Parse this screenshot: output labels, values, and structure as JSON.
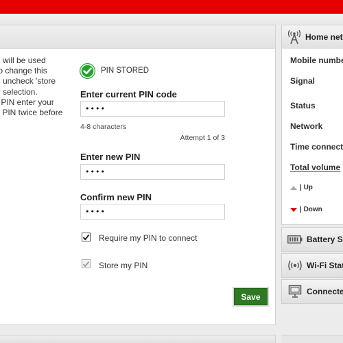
{
  "colors": {
    "brand_red": "#e60000",
    "ok_green": "#23a12e",
    "save_green": "#2d7a22",
    "down_red": "#e00000"
  },
  "help_text": "d will be used\nto change this\nd uncheck 'store\nir selection.\nr PIN enter your\nv PIN twice before",
  "status": {
    "icon": "check-circle-icon",
    "text": "PIN STORED"
  },
  "current_pin": {
    "label": "Enter current PIN code",
    "value": "••••",
    "hint": "4-8 characters",
    "attempt": "Attempt 1 of 3"
  },
  "new_pin": {
    "label": "Enter new PIN",
    "value": "••••"
  },
  "confirm_pin": {
    "label": "Confirm new PIN",
    "value": "••••"
  },
  "require_pin": {
    "label": "Require my PIN to connect",
    "checked": true
  },
  "store_pin": {
    "label": "Store my PIN",
    "checked": true,
    "disabled": true
  },
  "save_label": "Save",
  "sidebar": {
    "home_network": {
      "title": "Home netw",
      "icon": "antenna-tower-icon",
      "rows": [
        "Mobile numbe",
        "Signal",
        "Status",
        "Network",
        "Time connecte"
      ],
      "total_volume": "Total volume",
      "up": "| Up",
      "down": "| Down"
    },
    "battery": {
      "title": "Battery St",
      "icon": "battery-icon"
    },
    "wifi": {
      "title": "Wi-Fi Stat",
      "icon": "wifi-broadcast-icon"
    },
    "connected": {
      "title": "Connecte",
      "icon": "monitor-icon"
    }
  }
}
